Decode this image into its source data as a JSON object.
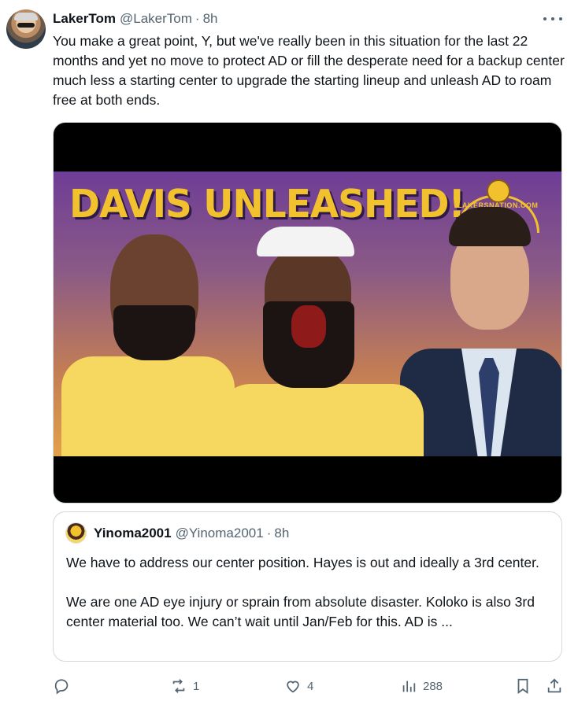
{
  "post": {
    "author": {
      "display_name": "LakerTom",
      "handle": "@LakerTom",
      "time": "8h"
    },
    "text": "You make a great point, Y, but we've really been in this situation for the last 22 months and yet no move to protect AD or fill the desperate need for a backup center much less a starting center to upgrade the starting lineup and unleash AD to roam free at both ends.",
    "media": {
      "headline": "DAVIS UNLEASHED!",
      "logo_text": "LAKERSNATION.COM"
    },
    "quoted": {
      "author": {
        "display_name": "Yinoma2001",
        "handle": "@Yinoma2001",
        "time": "8h"
      },
      "paragraph1": "We have to address our center position. Hayes is out and ideally a 3rd center.",
      "paragraph2": "We are one AD eye injury or sprain from absolute disaster. Koloko is also 3rd center material too. We can’t wait until Jan/Feb for this. AD is ..."
    },
    "actions": {
      "reply_count": "",
      "repost_count": "1",
      "like_count": "4",
      "view_count": "288"
    },
    "separator": "·"
  },
  "icons": {
    "more": "more-horizontal-icon",
    "reply": "reply-icon",
    "repost": "repost-icon",
    "like": "heart-icon",
    "views": "views-chart-icon",
    "bookmark": "bookmark-icon",
    "share": "share-icon"
  },
  "colors": {
    "text_primary": "#0f1419",
    "text_secondary": "#536471",
    "border": "#cfd9de",
    "lakers_gold": "#f2c12e",
    "lakers_purple": "#6e3d96"
  }
}
